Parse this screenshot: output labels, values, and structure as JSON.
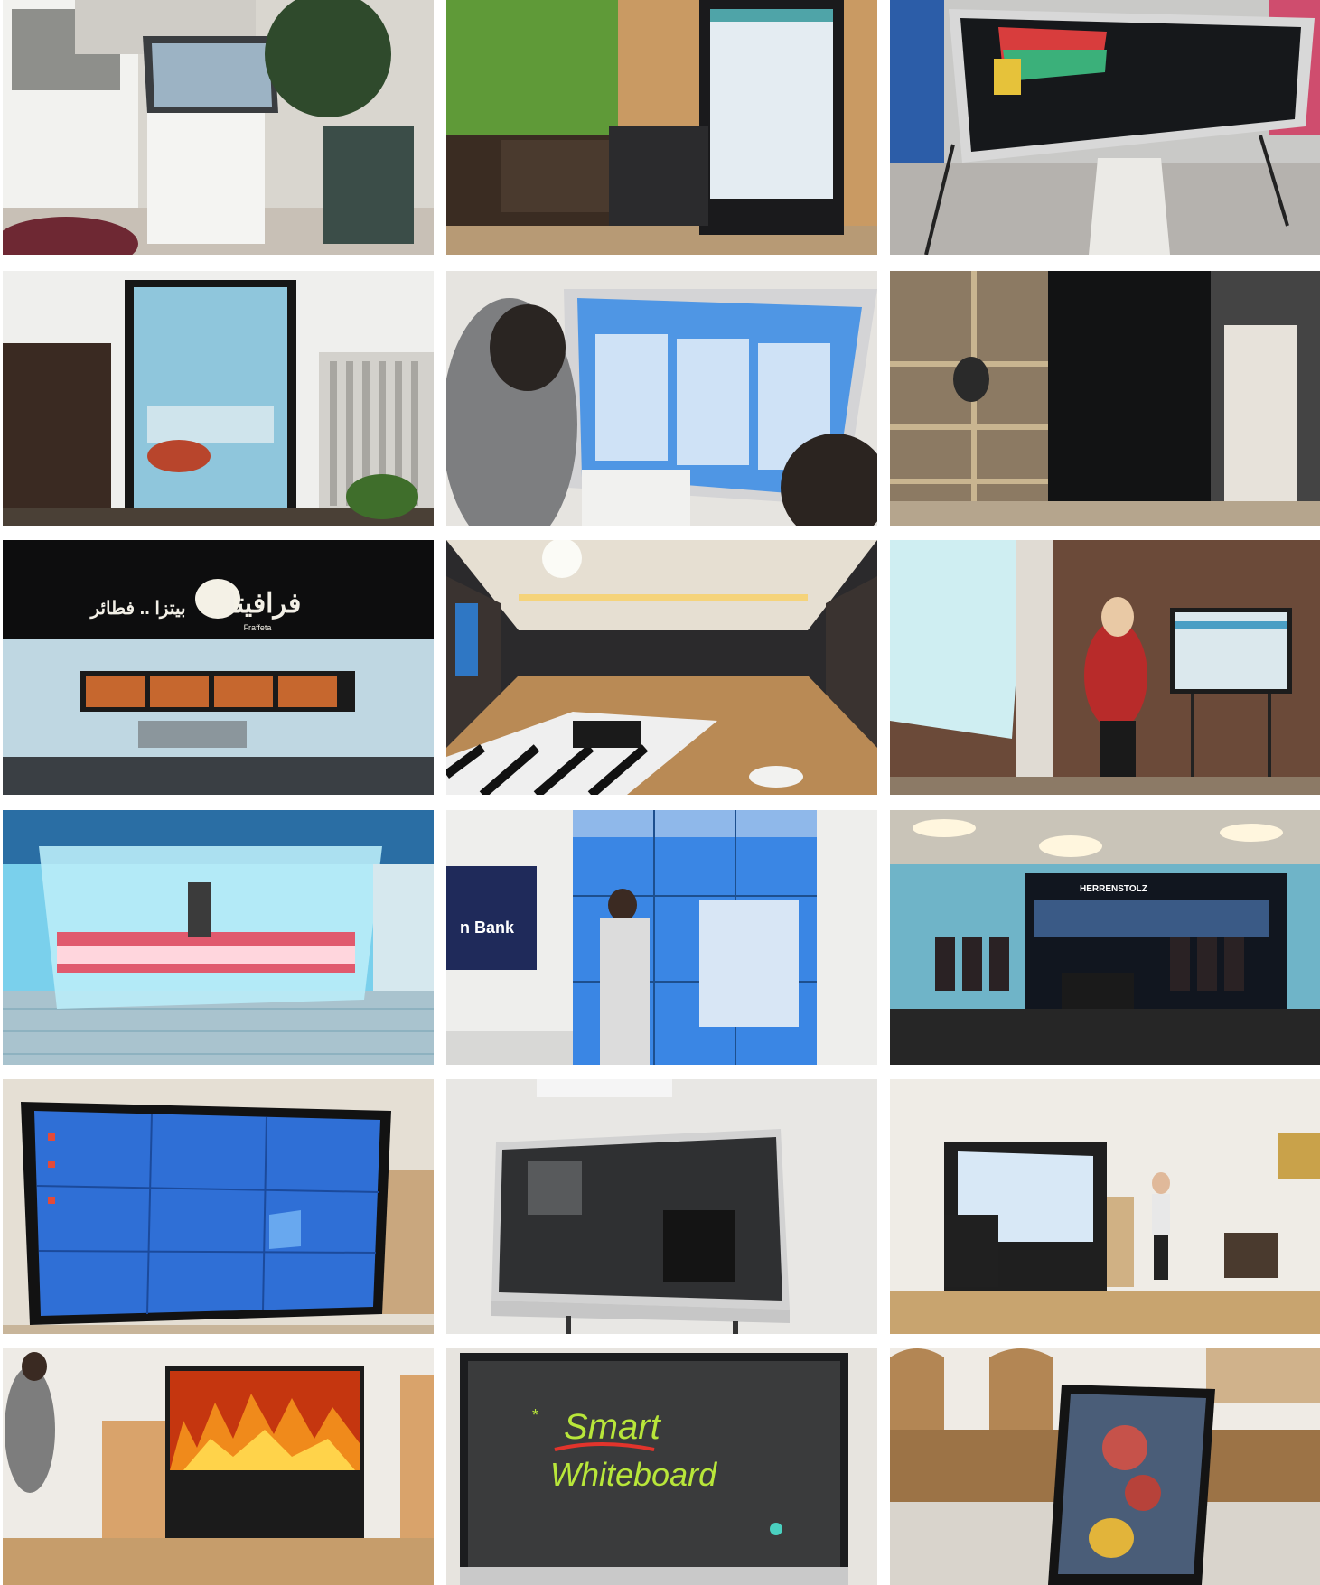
{
  "gallery": {
    "tiles": [
      {
        "scene": "kiosk-lobby"
      },
      {
        "scene": "portrait-signage-green-wall"
      },
      {
        "scene": "touch-table"
      },
      {
        "scene": "restaurant-tall-screen"
      },
      {
        "scene": "students-touch-screen"
      },
      {
        "scene": "black-portrait-totem"
      },
      {
        "scene": "pizza-shop-menu-boards",
        "sign_text": "فرافيتا",
        "sign_subtext": "بيتزا .. فطائر",
        "sign_brand": "Fraffeta"
      },
      {
        "scene": "hotel-corridor"
      },
      {
        "scene": "presenter-with-screen"
      },
      {
        "scene": "glass-kiosk-mall"
      },
      {
        "scene": "video-wall-presenter",
        "sign_text": "n Bank"
      },
      {
        "scene": "clothing-store-display",
        "sign_text": "HERRENSTOLZ"
      },
      {
        "scene": "video-wall-windows"
      },
      {
        "scene": "interactive-display-gray"
      },
      {
        "scene": "led-wall-stage"
      },
      {
        "scene": "fire-video-wall"
      },
      {
        "scene": "smart-whiteboard",
        "line1": "Smart",
        "line2": "Whiteboard"
      },
      {
        "scene": "easel-display-cafe"
      }
    ]
  },
  "colors": {
    "screen_blue": "#2f6fd6",
    "wall": "#e9e6e1",
    "floor_wood": "#b98a55",
    "dark": "#1b1b1d",
    "pizza_sign": "#f2efe6",
    "whiteboard_text_green": "#b8e63a",
    "whiteboard_underline_red": "#e2342c"
  }
}
